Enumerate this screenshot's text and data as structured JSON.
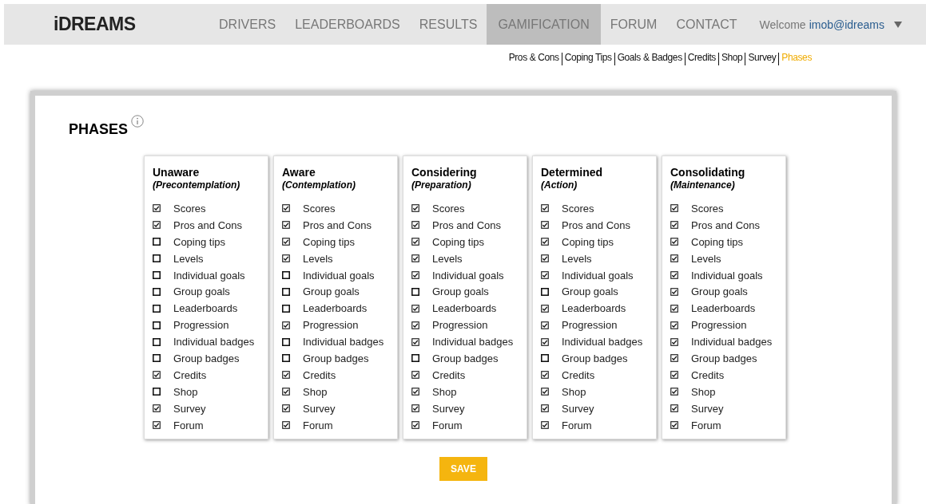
{
  "header": {
    "logo": "iDREAMS",
    "nav": [
      {
        "label": "DRIVERS",
        "selected": false
      },
      {
        "label": "LEADERBOARDS",
        "selected": false
      },
      {
        "label": "RESULTS",
        "selected": false
      },
      {
        "label": "GAMIFICATION",
        "selected": true
      },
      {
        "label": "FORUM",
        "selected": false
      },
      {
        "label": "CONTACT",
        "selected": false
      }
    ],
    "welcome": "Welcome",
    "user": "imob@idreams"
  },
  "subnav": [
    {
      "label": "Pros & Cons",
      "selected": false
    },
    {
      "label": "Coping Tips",
      "selected": false
    },
    {
      "label": "Goals & Badges",
      "selected": false
    },
    {
      "label": "Credits",
      "selected": false
    },
    {
      "label": "Shop",
      "selected": false
    },
    {
      "label": "Survey",
      "selected": false
    },
    {
      "label": "Phases",
      "selected": true
    }
  ],
  "title": "PHASES",
  "phases": [
    {
      "name": "Unaware",
      "stage": "(Precontemplation)",
      "features": [
        {
          "label": "Scores",
          "checked": true
        },
        {
          "label": "Pros and Cons",
          "checked": true
        },
        {
          "label": "Coping tips",
          "checked": false
        },
        {
          "label": "Levels",
          "checked": false
        },
        {
          "label": "Individual goals",
          "checked": false
        },
        {
          "label": "Group goals",
          "checked": false
        },
        {
          "label": "Leaderboards",
          "checked": false
        },
        {
          "label": "Progression",
          "checked": false
        },
        {
          "label": "Individual badges",
          "checked": false
        },
        {
          "label": "Group badges",
          "checked": false
        },
        {
          "label": "Credits",
          "checked": true
        },
        {
          "label": "Shop",
          "checked": false
        },
        {
          "label": "Survey",
          "checked": true
        },
        {
          "label": "Forum",
          "checked": true
        }
      ]
    },
    {
      "name": "Aware",
      "stage": "(Contemplation)",
      "features": [
        {
          "label": "Scores",
          "checked": true
        },
        {
          "label": "Pros and Cons",
          "checked": true
        },
        {
          "label": "Coping tips",
          "checked": true
        },
        {
          "label": "Levels",
          "checked": true
        },
        {
          "label": "Individual goals",
          "checked": false
        },
        {
          "label": "Group goals",
          "checked": false
        },
        {
          "label": "Leaderboards",
          "checked": false
        },
        {
          "label": "Progression",
          "checked": true
        },
        {
          "label": "Individual badges",
          "checked": false
        },
        {
          "label": "Group badges",
          "checked": false
        },
        {
          "label": "Credits",
          "checked": true
        },
        {
          "label": "Shop",
          "checked": true
        },
        {
          "label": "Survey",
          "checked": true
        },
        {
          "label": "Forum",
          "checked": true
        }
      ]
    },
    {
      "name": "Considering",
      "stage": "(Preparation)",
      "features": [
        {
          "label": "Scores",
          "checked": true
        },
        {
          "label": "Pros and Cons",
          "checked": true
        },
        {
          "label": "Coping tips",
          "checked": true
        },
        {
          "label": "Levels",
          "checked": true
        },
        {
          "label": "Individual goals",
          "checked": true
        },
        {
          "label": "Group goals",
          "checked": false
        },
        {
          "label": "Leaderboards",
          "checked": true
        },
        {
          "label": "Progression",
          "checked": true
        },
        {
          "label": "Individual badges",
          "checked": true
        },
        {
          "label": "Group badges",
          "checked": false
        },
        {
          "label": "Credits",
          "checked": true
        },
        {
          "label": "Shop",
          "checked": true
        },
        {
          "label": "Survey",
          "checked": true
        },
        {
          "label": "Forum",
          "checked": true
        }
      ]
    },
    {
      "name": "Determined",
      "stage": "(Action)",
      "features": [
        {
          "label": "Scores",
          "checked": true
        },
        {
          "label": "Pros and Cons",
          "checked": true
        },
        {
          "label": "Coping tips",
          "checked": true
        },
        {
          "label": "Levels",
          "checked": true
        },
        {
          "label": "Individual goals",
          "checked": true
        },
        {
          "label": "Group goals",
          "checked": false
        },
        {
          "label": "Leaderboards",
          "checked": true
        },
        {
          "label": "Progression",
          "checked": true
        },
        {
          "label": "Individual badges",
          "checked": true
        },
        {
          "label": "Group badges",
          "checked": false
        },
        {
          "label": "Credits",
          "checked": true
        },
        {
          "label": "Shop",
          "checked": true
        },
        {
          "label": "Survey",
          "checked": true
        },
        {
          "label": "Forum",
          "checked": true
        }
      ]
    },
    {
      "name": "Consolidating",
      "stage": "(Maintenance)",
      "features": [
        {
          "label": "Scores",
          "checked": true
        },
        {
          "label": "Pros and Cons",
          "checked": true
        },
        {
          "label": "Coping tips",
          "checked": true
        },
        {
          "label": "Levels",
          "checked": true
        },
        {
          "label": "Individual goals",
          "checked": true
        },
        {
          "label": "Group goals",
          "checked": true
        },
        {
          "label": "Leaderboards",
          "checked": true
        },
        {
          "label": "Progression",
          "checked": true
        },
        {
          "label": "Individual badges",
          "checked": true
        },
        {
          "label": "Group badges",
          "checked": true
        },
        {
          "label": "Credits",
          "checked": true
        },
        {
          "label": "Shop",
          "checked": true
        },
        {
          "label": "Survey",
          "checked": true
        },
        {
          "label": "Forum",
          "checked": true
        }
      ]
    }
  ],
  "save": "SAVE"
}
